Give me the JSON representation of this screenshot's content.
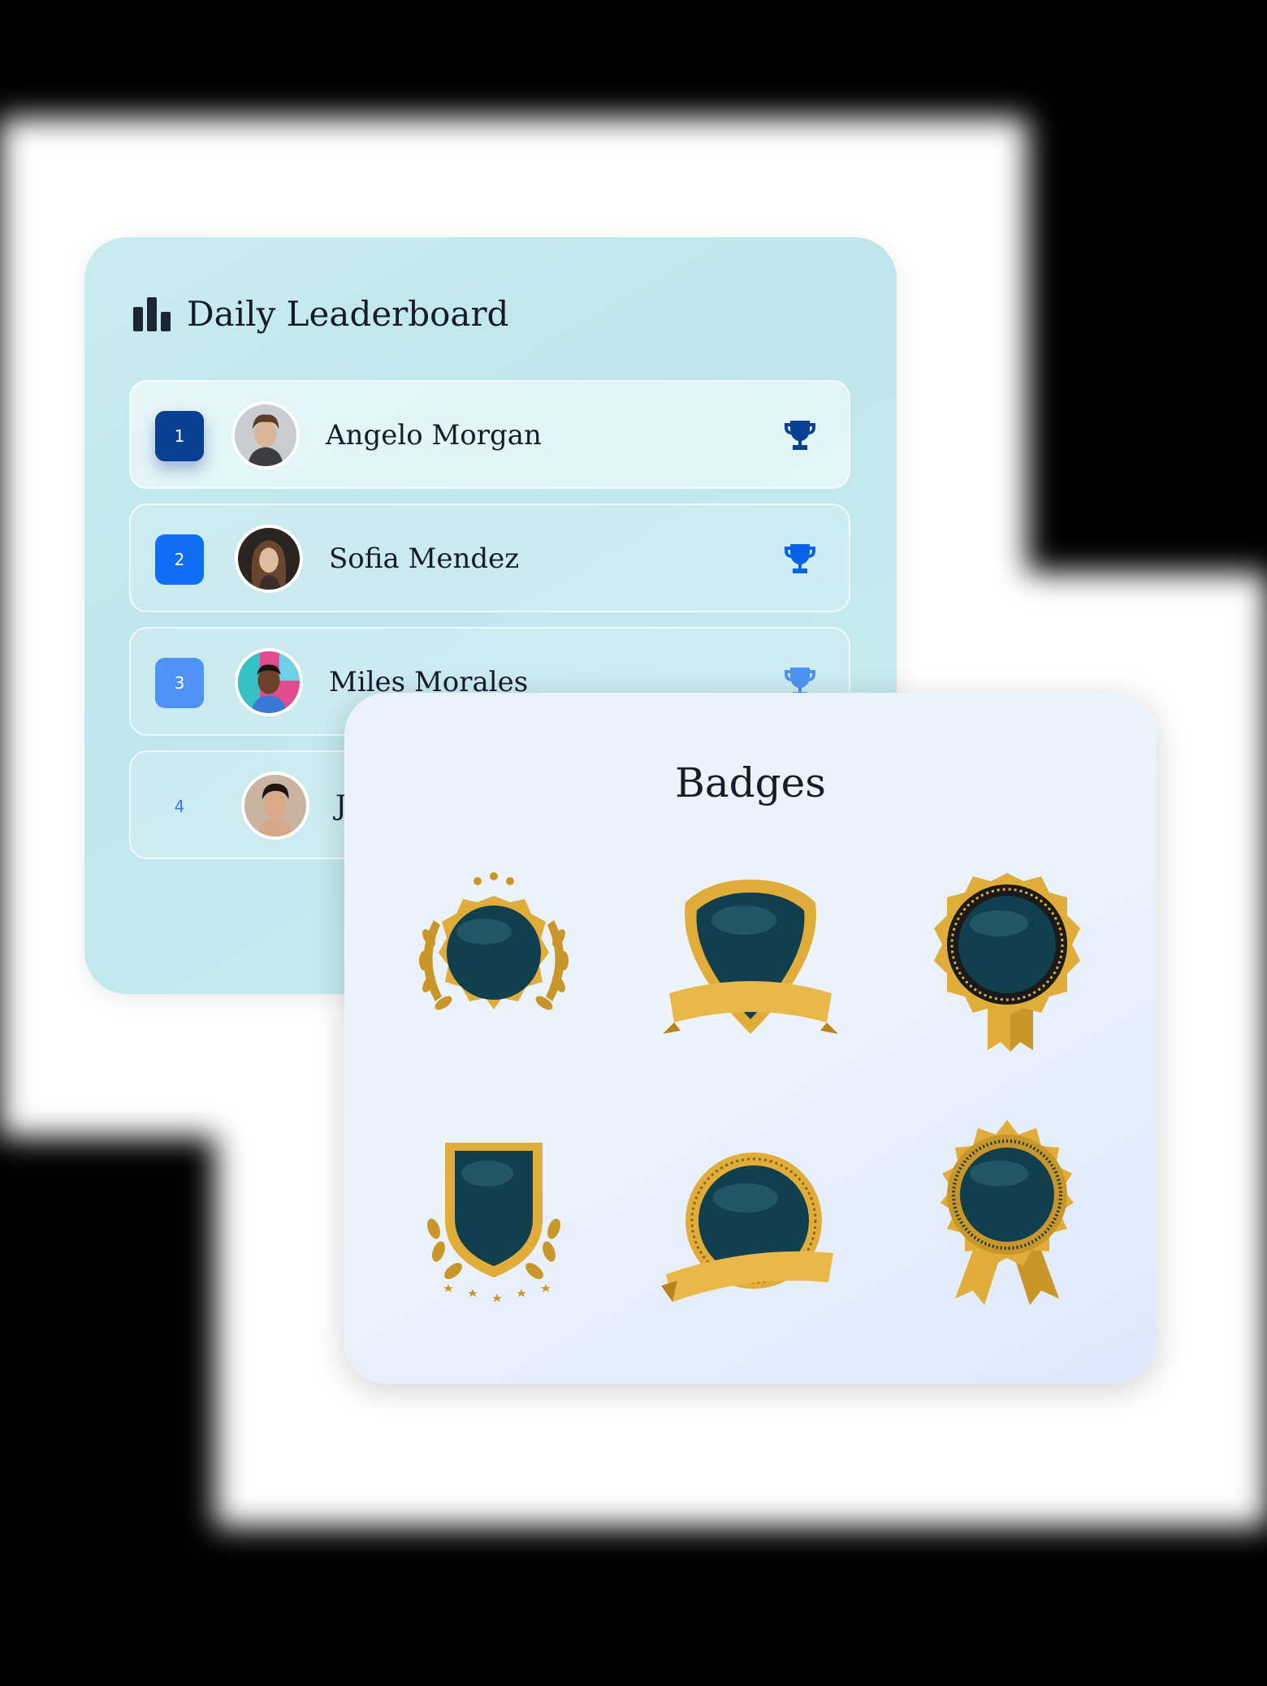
{
  "leaderboard": {
    "title": "Daily Leaderboard",
    "icon": "bar-chart-icon",
    "players": [
      {
        "rank": "1",
        "name": "Angelo Morgan",
        "trophy": "trophy-icon"
      },
      {
        "rank": "2",
        "name": "Sofia Mendez",
        "trophy": "trophy-icon"
      },
      {
        "rank": "3",
        "name": "Miles Morales",
        "trophy": "trophy-icon"
      },
      {
        "rank": "4",
        "name": "J"
      }
    ]
  },
  "badges": {
    "title": "Badges",
    "items": [
      {
        "icon": "laurel-wreath-badge-icon"
      },
      {
        "icon": "shield-ribbon-badge-icon"
      },
      {
        "icon": "rosette-ribbon-badge-icon"
      },
      {
        "icon": "shield-laurel-badge-icon"
      },
      {
        "icon": "circle-ribbon-badge-icon"
      },
      {
        "icon": "seal-ribbon-badge-icon"
      }
    ]
  },
  "colors": {
    "rank_1": "#0b3f92",
    "rank_2": "#0f6ef5",
    "rank_3": "#4f93f6",
    "trophy": "#0a55d8",
    "badge_gold": "#d9a830",
    "badge_center": "#123f4e"
  }
}
